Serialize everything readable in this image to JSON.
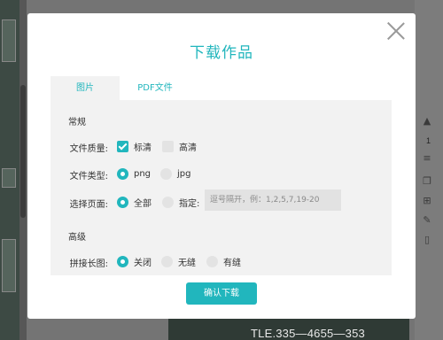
{
  "background": {
    "page_number": "1",
    "canvas_text": "TLE.335—4655—353"
  },
  "modal": {
    "title": "下载作品",
    "tabs": [
      {
        "label": "图片",
        "active": true
      },
      {
        "label": "PDF文件",
        "active": false
      }
    ],
    "sections": {
      "general": "常规",
      "advanced": "高级"
    },
    "quality": {
      "label": "文件质量:",
      "options": [
        {
          "label": "标清",
          "checked": true
        },
        {
          "label": "高清",
          "checked": false
        }
      ]
    },
    "file_type": {
      "label": "文件类型:",
      "options": [
        {
          "label": "png",
          "selected": true
        },
        {
          "label": "jpg",
          "selected": false
        }
      ]
    },
    "pages": {
      "label": "选择页面:",
      "options": [
        {
          "label": "全部",
          "selected": true
        },
        {
          "label": "指定:",
          "selected": false
        }
      ],
      "input_placeholder": "逗号隔开，例：1,2,5,7,19-20",
      "input_value": ""
    },
    "stitch": {
      "label": "拼接长图:",
      "options": [
        {
          "label": "关闭",
          "selected": true
        },
        {
          "label": "无缝",
          "selected": false
        },
        {
          "label": "有缝",
          "selected": false
        }
      ]
    },
    "confirm_label": "确认下载"
  },
  "colors": {
    "accent": "#21b6bd",
    "panel_bg": "#f2f2f2",
    "overlay": "#747474"
  }
}
